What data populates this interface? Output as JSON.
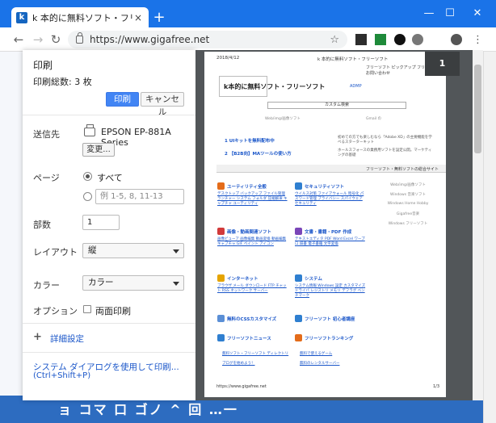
{
  "browser": {
    "tab_title": "k 本的に無料ソフト・フリーソフト",
    "favicon_letter": "k",
    "new_tab": "+",
    "url": "https://www.gigafree.net",
    "ext_labels": [
      "",
      "",
      "",
      ""
    ]
  },
  "background": {
    "footer_text": "ョ コマ 口 ゴノ ^ 回 …一"
  },
  "print": {
    "title": "印刷",
    "total": "印刷総数: 3 枚",
    "print_label": "印刷",
    "cancel_label": "キャンセル",
    "destination_label": "送信先",
    "printer_name": "EPSON EP-881A Series",
    "change_label": "変更...",
    "pages_label": "ページ",
    "pages_all": "すべて",
    "pages_placeholder": "例 1-5, 8, 11-13",
    "copies_label": "部数",
    "copies_value": "1",
    "layout_label": "レイアウト",
    "layout_value": "縦",
    "color_label": "カラー",
    "color_value": "カラー",
    "options_label": "オプション",
    "duplex_label": "両面印刷",
    "advanced_label": "詳細設定",
    "system_dialog_label": "システム ダイアログを使用して印刷...",
    "system_dialog_shortcut": "(Ctrl+Shift+P)"
  },
  "preview": {
    "page_number": "1",
    "date": "2018/4/12",
    "header": "k 本的に無料ソフト・フリーソフト",
    "nav": "フリーソフト  ピックアップ  フリーソフト  お問い合わせ",
    "logo": "k本的に無料ソフト・フリーソフト",
    "admp": "ADMP",
    "search_text": "カスタム検索",
    "mini1": "Web/img/画像ソフト",
    "mini2": "Gmail の",
    "mini3": "",
    "banner1": "1 UIキットを無料配布中",
    "banner1_text": "初めての方でも楽しむなら「Adobe XD」の主要機能を学べるスターターキット",
    "banner2": "2 【B2B向】MAツールの使い方",
    "banner2_text": "ホールスフォースの業務用ソフトを設定公開。マーケティングの基礎",
    "bar_text": "フリーソフト・無料ソフトの総合サイト",
    "categories": [
      {
        "title": "ユーティリティ全般",
        "color": "#e46c1a",
        "subs": "デスクトップ  バックアップ  ファイル管理  ランチャー  システム  フォルダ  圧縮解凍  キャプチャ  ユーティリティ"
      },
      {
        "title": "セキュリティソフト",
        "color": "#2f7fd0",
        "subs": "ウイルス対策  ファイアウォール  暗号化  パスワード管理  プライバシー  スパイウェア  セキュリティ"
      },
      {
        "title": "画像・動画関連ソフト",
        "color": "#d23a3a",
        "subs": "画像ビューア  画像編集  動画変換  動画編集  キャプチャ  GIF  ペイント  アイコン"
      },
      {
        "title": "文書・書籍・PDF 作成",
        "color": "#7a46b8",
        "subs": "テキストエディタ  PDF  Word  Excel  ワープロ  辞書  電子書籍  文字変換"
      },
      {
        "title": "インターネット",
        "color": "#e5a400",
        "subs": "ブラウザ  メール  ダウンロード  FTP  チャット  RSS  ネットワーク  サーバー"
      },
      {
        "title": "システム",
        "color": "#2f7fd0",
        "subs": "システム情報  Windows 設定  カスタマイズ  ドライバ  レジストリ  メモリ  デフラグ  ベンチマーク"
      }
    ],
    "extra_links": [
      {
        "title": "無料のCSSカスタマイズ",
        "color": "#5b8fd6"
      },
      {
        "title": "フリーソフト 初心者講座",
        "color": "#2f7fd0"
      },
      {
        "title": "フリーソフトニュース",
        "color": "#2f7fd0"
      },
      {
        "title": "フリーソフトランキング",
        "color": "#e46c1a"
      }
    ],
    "small_links": [
      "無料ソフト・フリーソフト ディレクトリ",
      "無料で使えるゲーム",
      "ブログを始めよう！",
      "無料のレンタルサーバー"
    ],
    "side_items": [
      "Web/img/画像ソフト",
      "Windows 音楽ソフト",
      "Windows Home Hobby",
      "Gigafree音楽",
      "Windows フリーソフト"
    ],
    "footer_url": "https://www.gigafree.net",
    "footer_page": "1/3"
  }
}
